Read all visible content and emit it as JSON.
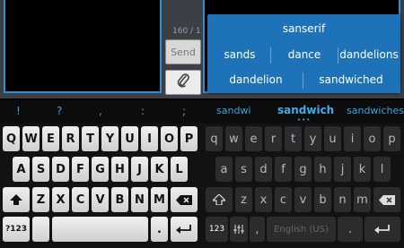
{
  "composer": {
    "counter": "160 / 1",
    "send_label": "Send"
  },
  "popup": {
    "words": [
      "sanserif",
      "sands",
      "dance",
      "dandelions",
      "dandelion",
      "sandwiched"
    ]
  },
  "suggestion_bar": {
    "symbols": [
      "!",
      "?",
      ",",
      ":",
      ";"
    ],
    "left": "sandwi",
    "center": "sandwich",
    "right": "sandwiches"
  },
  "keyboard_left": {
    "row1": [
      "Q",
      "W",
      "E",
      "R",
      "T",
      "Y",
      "U",
      "I",
      "O",
      "P"
    ],
    "row2": [
      "A",
      "S",
      "D",
      "F",
      "G",
      "H",
      "J",
      "K",
      "L"
    ],
    "row3": [
      "Z",
      "X",
      "C",
      "V",
      "B",
      "N",
      "M"
    ],
    "sym_label": "?123",
    "period": "."
  },
  "keyboard_right": {
    "row1": [
      "q",
      "w",
      "e",
      "r",
      "t",
      "y",
      "u",
      "i",
      "o",
      "p"
    ],
    "row2": [
      "a",
      "s",
      "d",
      "f",
      "g",
      "h",
      "j",
      "k",
      "l"
    ],
    "row3": [
      "z",
      "x",
      "c",
      "v",
      "b",
      "n",
      "m"
    ],
    "sym_label": "123",
    "comma": ",",
    "space_label": "English (US)",
    "period": "."
  },
  "icons": [
    "paperclip-icon",
    "shift-icon",
    "backspace-icon",
    "enter-icon",
    "settings-icon"
  ]
}
